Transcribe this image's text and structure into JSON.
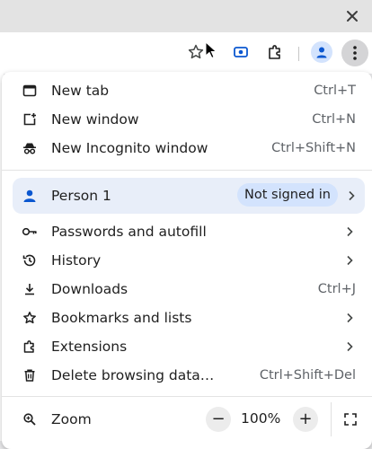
{
  "menu": {
    "new_tab": {
      "label": "New tab",
      "shortcut": "Ctrl+T"
    },
    "new_window": {
      "label": "New window",
      "shortcut": "Ctrl+N"
    },
    "new_incognito": {
      "label": "New Incognito window",
      "shortcut": "Ctrl+Shift+N"
    },
    "profile": {
      "name": "Person 1",
      "status": "Not signed in"
    },
    "passwords": {
      "label": "Passwords and autofill"
    },
    "history": {
      "label": "History"
    },
    "downloads": {
      "label": "Downloads",
      "shortcut": "Ctrl+J"
    },
    "bookmarks": {
      "label": "Bookmarks and lists"
    },
    "extensions": {
      "label": "Extensions"
    },
    "delete_data": {
      "label": "Delete browsing data…",
      "shortcut": "Ctrl+Shift+Del"
    },
    "zoom": {
      "label": "Zoom",
      "value": "100%",
      "minus": "−",
      "plus": "+"
    }
  },
  "icons": {
    "close": "close-icon",
    "bookmark_star": "star-icon",
    "screen_capture": "screen-capture-icon",
    "extensions": "puzzle-icon",
    "profile": "person-icon",
    "menu": "more-vertical-icon"
  },
  "colors": {
    "accent": "#0b57d0",
    "profile_row": "#e8eef9",
    "badge": "#d3e3fd"
  }
}
